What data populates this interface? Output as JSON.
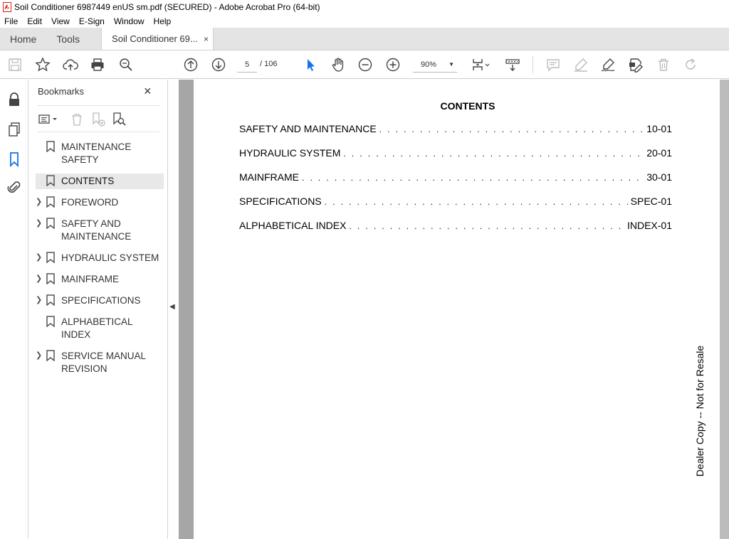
{
  "window": {
    "title": "Soil Conditioner 6987449 enUS sm.pdf (SECURED) - Adobe Acrobat Pro (64-bit)",
    "accent_color": "#d9211f"
  },
  "menu": {
    "items": [
      "File",
      "Edit",
      "View",
      "E-Sign",
      "Window",
      "Help"
    ]
  },
  "tabs": {
    "home": "Home",
    "tools": "Tools",
    "document": "Soil Conditioner 69...",
    "close": "×"
  },
  "toolbar": {
    "icons": [
      "save-icon",
      "star-icon",
      "upload-icon",
      "print-icon",
      "zoom-search-icon",
      "page-up-icon",
      "page-down-icon",
      "select-arrow-icon",
      "hand-icon",
      "zoom-out-icon",
      "zoom-in-icon",
      "fit-page-icon",
      "scroll-mode-icon",
      "comment-icon",
      "highlight-icon",
      "sign-icon",
      "edit-pdf-icon",
      "delete-icon",
      "rotate-icon"
    ],
    "current_page": "5",
    "page_separator": "/ 106",
    "zoom": "90%"
  },
  "bookmarks_panel": {
    "header": "Bookmarks",
    "close": "×",
    "items": [
      {
        "label": "MAINTENANCE SAFETY",
        "expandable": false,
        "selected": false
      },
      {
        "label": "CONTENTS",
        "expandable": false,
        "selected": true
      },
      {
        "label": "FOREWORD",
        "expandable": true,
        "selected": false
      },
      {
        "label": "SAFETY AND MAINTENANCE",
        "expandable": true,
        "selected": false
      },
      {
        "label": "HYDRAULIC SYSTEM",
        "expandable": true,
        "selected": false
      },
      {
        "label": "MAINFRAME",
        "expandable": true,
        "selected": false
      },
      {
        "label": "SPECIFICATIONS",
        "expandable": true,
        "selected": false
      },
      {
        "label": "ALPHABETICAL INDEX",
        "expandable": false,
        "selected": false
      },
      {
        "label": "SERVICE MANUAL REVISION",
        "expandable": true,
        "selected": false
      }
    ]
  },
  "document": {
    "title": "CONTENTS",
    "toc": [
      {
        "label": "SAFETY AND MAINTENANCE",
        "page": "10-01"
      },
      {
        "label": "HYDRAULIC SYSTEM",
        "page": "20-01"
      },
      {
        "label": "MAINFRAME",
        "page": "30-01"
      },
      {
        "label": "SPECIFICATIONS",
        "page": "SPEC-01"
      },
      {
        "label": "ALPHABETICAL INDEX",
        "page": "INDEX-01"
      }
    ],
    "watermark": "Dealer Copy -- Not for Resale"
  }
}
